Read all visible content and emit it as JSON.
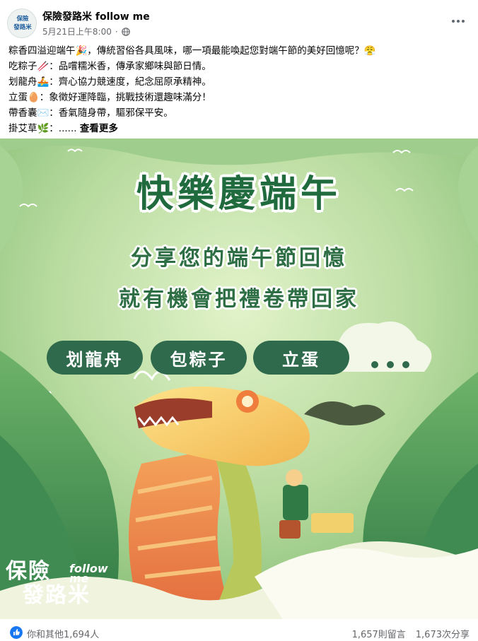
{
  "post": {
    "page_name": "保險發路米 follow me",
    "timestamp": "5月21日上午8:00",
    "dot": "·",
    "avatar_text": [
      "保險",
      "發路米"
    ]
  },
  "text_lines": [
    "粽香四溢迎端午🎉，傳統習俗各具風味，哪一項最能喚起您對端午節的美好回憶呢？😤",
    "吃粽子🥢：品嚐糯米香，傳承家鄉味與節日情。",
    "划龍舟🚣：齊心協力競速度，紀念屈原承精神。",
    "立蛋🥚：象徵好運降臨，挑戰技術還趣味滿分！",
    "帶香囊✉️：香氣隨身帶，驅邪保平安。",
    "掛艾草🌿：......"
  ],
  "see_more": "查看更多",
  "banner": {
    "title": "快樂慶端午",
    "subtitle_1": "分享您的端午節回憶",
    "subtitle_2": "就有機會把禮卷帶回家",
    "options": [
      "划龍舟",
      "包粽子",
      "立蛋"
    ],
    "brand_line1": "保險",
    "brand_line2": "發路米",
    "brand_follow": "follow",
    "brand_me": "me"
  },
  "footer": {
    "reactions": "你和其他1,694人",
    "comments": "1,657則留言",
    "shares": "1,673次分享"
  },
  "colors": {
    "brand_green": "#2f6a4c",
    "facebook_blue": "#1877f2",
    "meta_gray": "#65676b"
  },
  "icons": [
    "globe-icon",
    "more-options-icon",
    "like-icon"
  ]
}
